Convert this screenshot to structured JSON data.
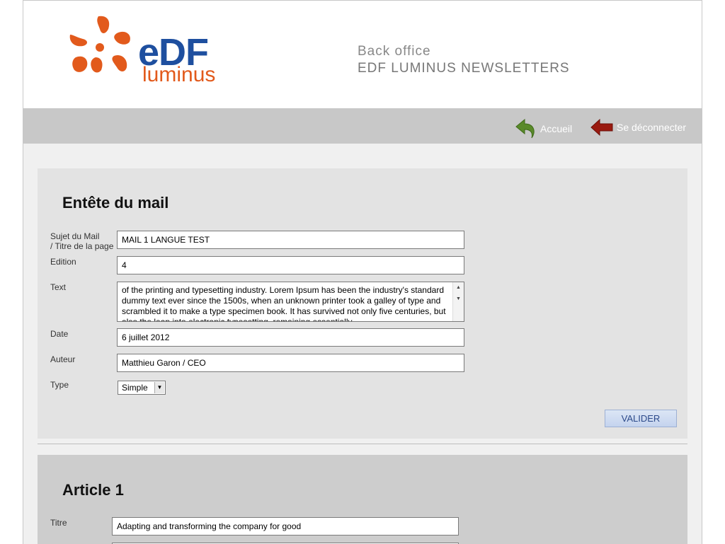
{
  "header": {
    "logo": {
      "word1": "eDF",
      "word2": "luminus"
    },
    "title_line1": "Back office",
    "title_line2": "EDF LUMINUS NEWSLETTERS"
  },
  "nav": {
    "home": {
      "label": "Accueil",
      "icon": "green-back-arrow-icon"
    },
    "logout": {
      "label": "Se déconnecter",
      "icon": "red-left-arrow-icon"
    }
  },
  "mail_header": {
    "heading": "Entête du mail",
    "subject_label_1": "Sujet du Mail",
    "subject_label_2": "/ Titre de la page",
    "subject_value": "MAIL 1 LANGUE TEST",
    "edition_label": "Edition",
    "edition_value": "4",
    "text_label": "Text",
    "text_value": "of the printing and typesetting industry. Lorem Ipsum has been the industry's standard dummy text ever since the 1500s, when an unknown printer took a galley of type and scrambled it to make a type specimen book. It has survived not only five centuries, but also the leap into electronic typesetting, remaining essentially",
    "date_label": "Date",
    "date_value": "6 juillet 2012",
    "author_label": "Auteur",
    "author_value": "Matthieu Garon / CEO",
    "type_label": "Type",
    "type_value": "Simple",
    "submit_label": "VALIDER"
  },
  "article1": {
    "heading": "Article 1",
    "title_label": "Titre",
    "title_value": "Adapting and transforming the company for good"
  },
  "colors": {
    "brand_orange": "#e25a1c",
    "brand_blue": "#1e4f9f",
    "navbar": "#c8c8c8"
  }
}
